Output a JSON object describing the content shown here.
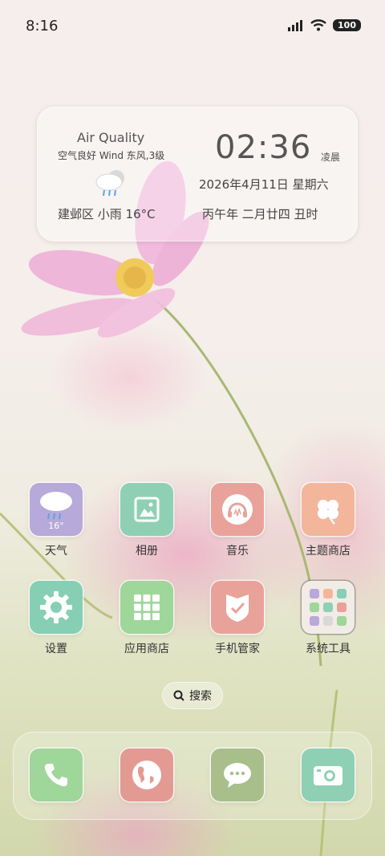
{
  "status_bar": {
    "time": "8:16",
    "battery": "100"
  },
  "widget": {
    "air_quality_title": "Air Quality",
    "air_quality_detail": "空气良好 Wind 东风,3级",
    "location_weather": "建邺区  小雨  16°C",
    "clock": "02:36",
    "clock_period": "凌晨",
    "date": "2026年4月11日   星期六",
    "lunar": "丙午年   二月廿四   丑时"
  },
  "apps": [
    {
      "label": "天气",
      "icon": "weather-icon",
      "color": "#b7a9d9",
      "badge": "16°"
    },
    {
      "label": "相册",
      "icon": "gallery-icon",
      "color": "#8fd0b4"
    },
    {
      "label": "音乐",
      "icon": "music-icon",
      "color": "#e9a29a"
    },
    {
      "label": "主题商店",
      "icon": "clover-icon",
      "color": "#f3b69a"
    },
    {
      "label": "设置",
      "icon": "gear-icon",
      "color": "#86cfb4"
    },
    {
      "label": "应用商店",
      "icon": "grid-icon",
      "color": "#9fd69a"
    },
    {
      "label": "手机管家",
      "icon": "shield-icon",
      "color": "#e9a29a"
    },
    {
      "label": "系统工具",
      "icon": "folder-icon",
      "color": "#f2ece6"
    }
  ],
  "search": {
    "label": "搜索"
  },
  "dock": [
    {
      "icon": "phone-icon",
      "color": "#9fd69a"
    },
    {
      "icon": "browser-icon",
      "color": "#e39a92"
    },
    {
      "icon": "messages-icon",
      "color": "#a8bf8c"
    },
    {
      "icon": "camera-icon",
      "color": "#8fd0b4"
    }
  ]
}
